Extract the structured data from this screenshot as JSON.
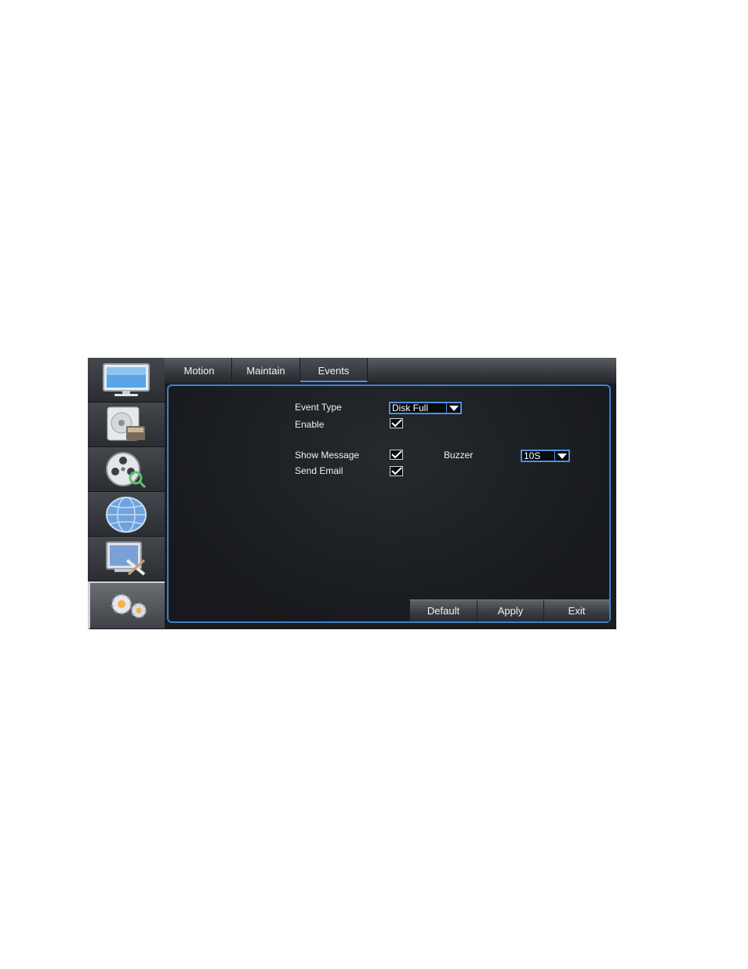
{
  "tabs": [
    {
      "label": "Motion"
    },
    {
      "label": "Maintain"
    },
    {
      "label": "Events"
    }
  ],
  "active_tab": "Events",
  "sidebar": {
    "items": [
      {
        "icon": "monitor-icon"
      },
      {
        "icon": "record-disk-icon"
      },
      {
        "icon": "film-reel-search-icon"
      },
      {
        "icon": "network-globe-icon"
      },
      {
        "icon": "screen-tools-icon"
      },
      {
        "icon": "gears-icon",
        "active": true
      }
    ]
  },
  "form": {
    "event_type_label": "Event Type",
    "event_type_value": "Disk Full",
    "enable_label": "Enable",
    "enable_checked": true,
    "show_message_label": "Show Message",
    "show_message_checked": true,
    "buzzer_label": "Buzzer",
    "buzzer_value": "10S",
    "send_email_label": "Send Email",
    "send_email_checked": true
  },
  "buttons": {
    "default_label": "Default",
    "apply_label": "Apply",
    "exit_label": "Exit"
  },
  "colors": {
    "accent": "#4f8fe2",
    "panel_bg": "#1a1c1f",
    "text": "#f0f0f0"
  }
}
